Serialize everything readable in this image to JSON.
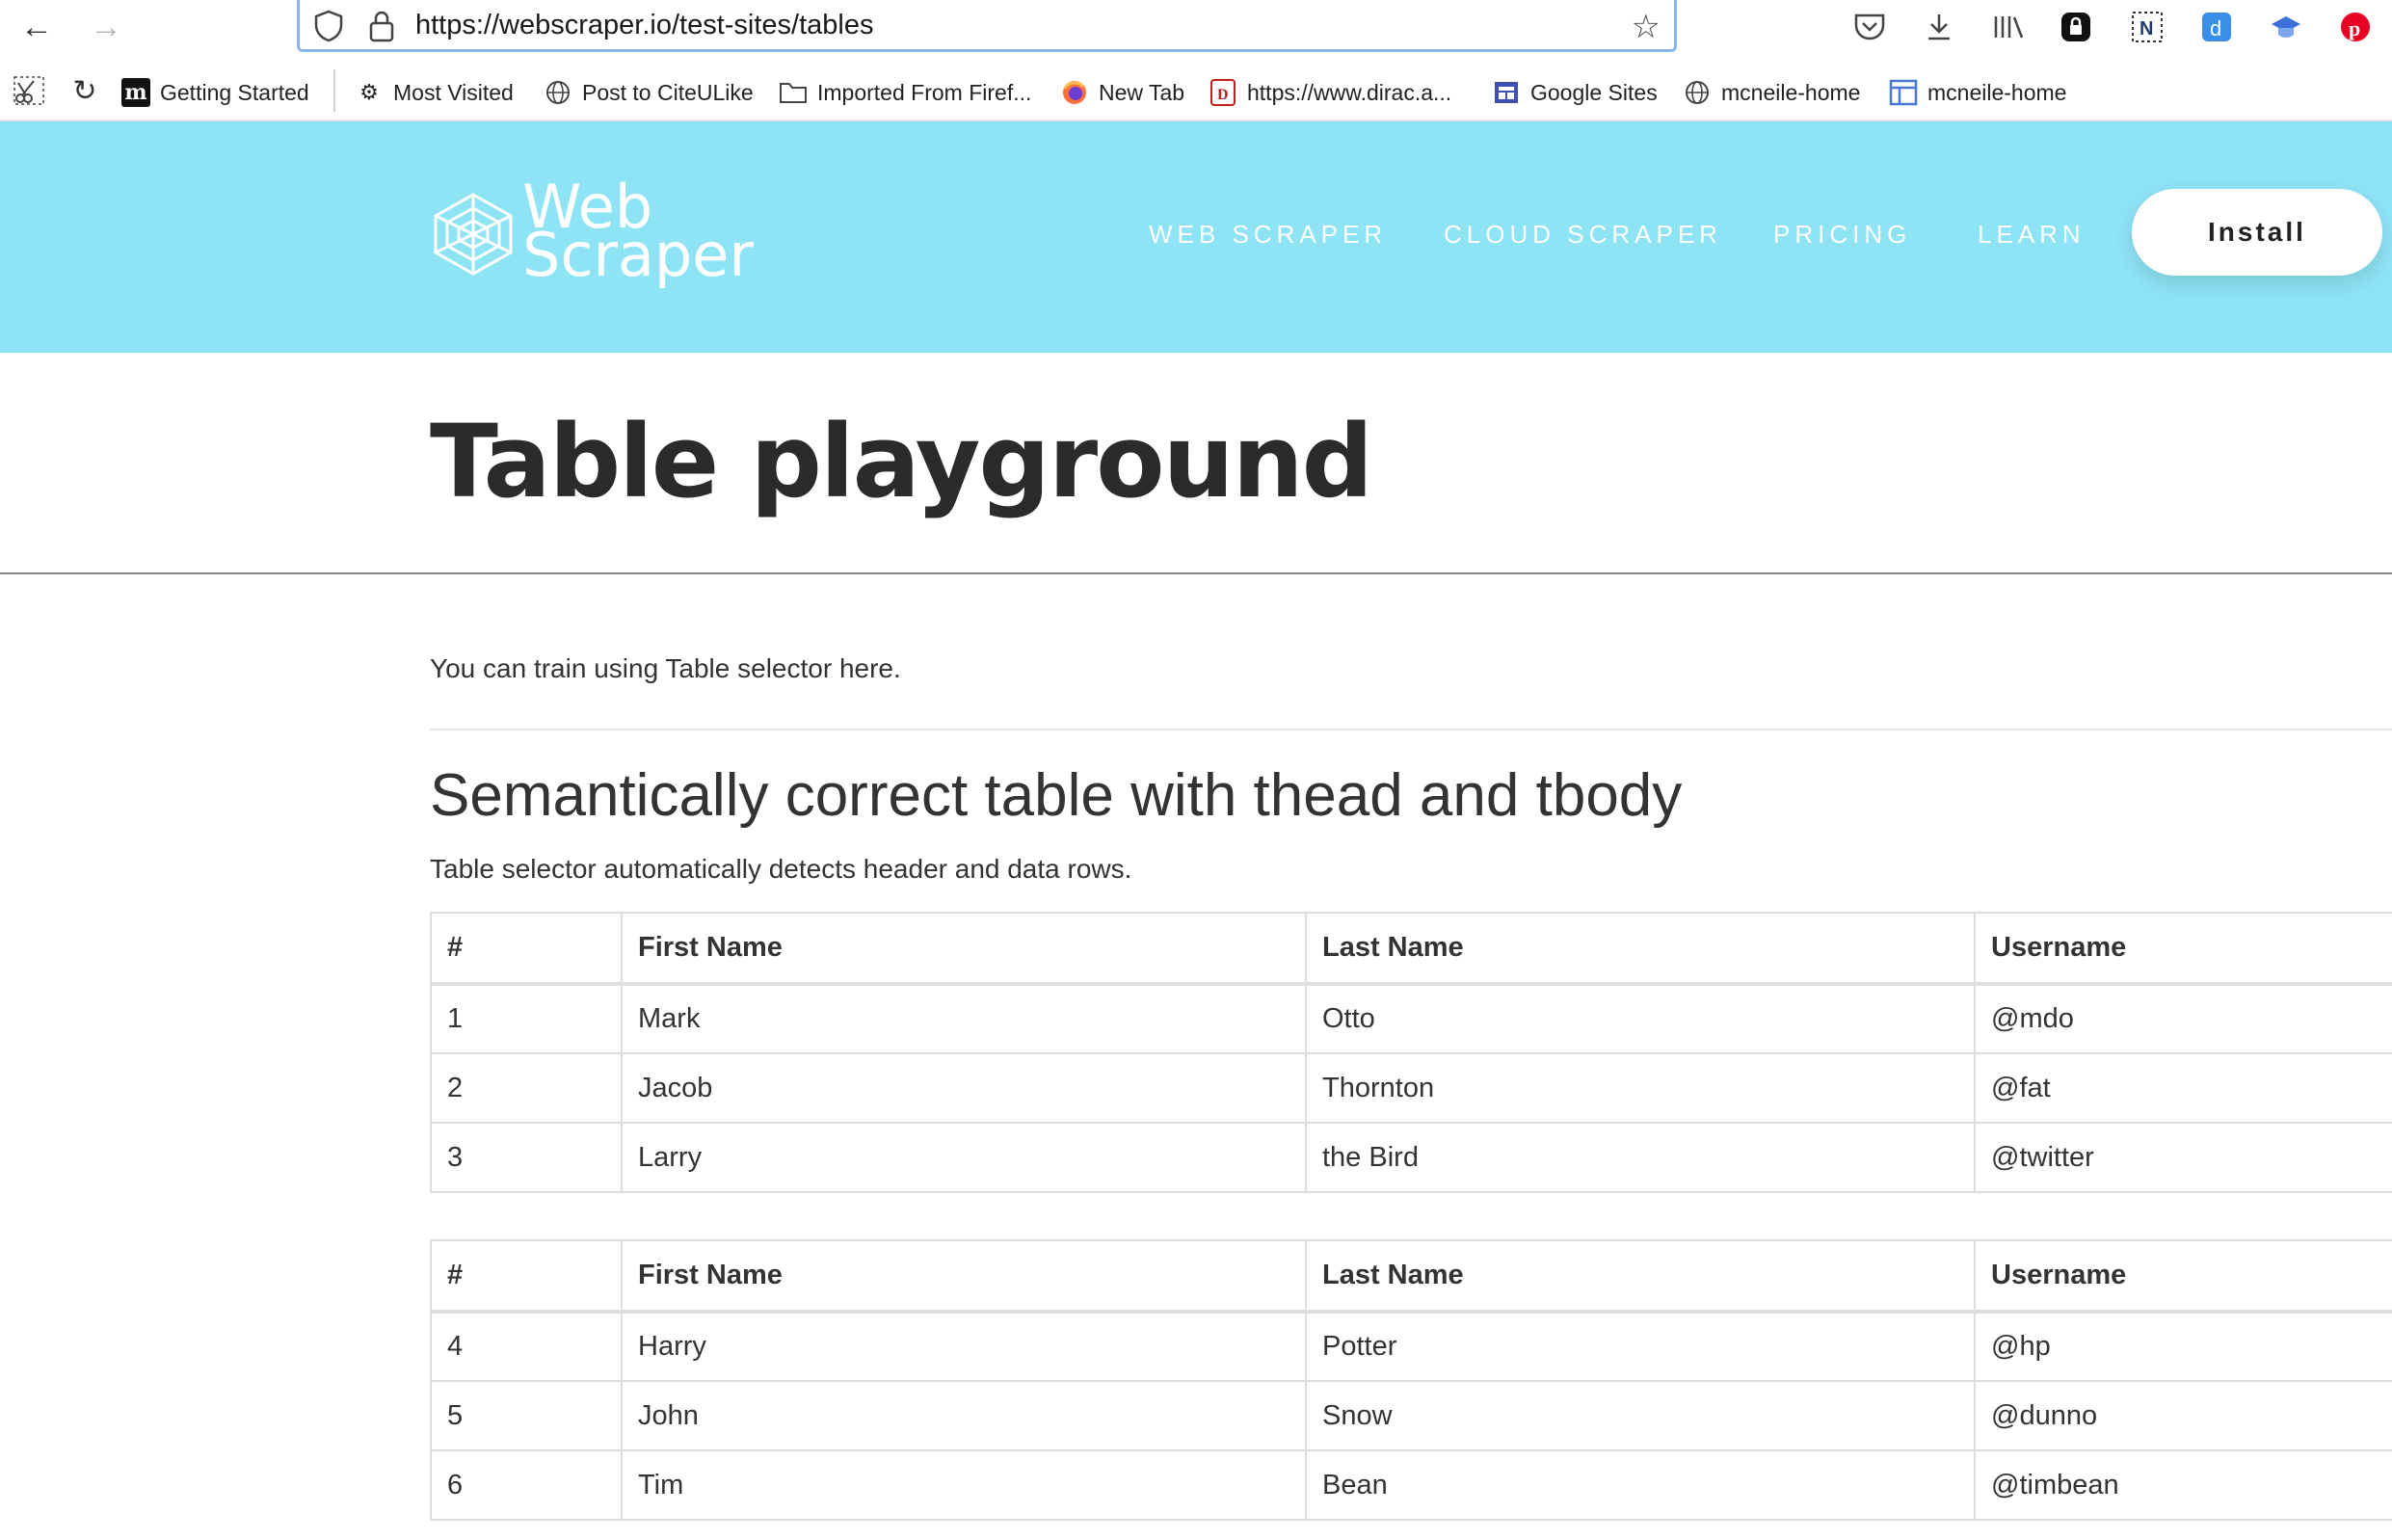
{
  "browser": {
    "url": "https://webscraper.io/test-sites/tables",
    "bookmarks": [
      {
        "label": "Getting Started",
        "icon": "m-logo-icon"
      },
      {
        "label": "Most Visited",
        "icon": "gear-icon"
      },
      {
        "label": "Post to CiteULike",
        "icon": "globe-icon"
      },
      {
        "label": "Imported From Firef...",
        "icon": "folder-icon"
      },
      {
        "label": "New Tab",
        "icon": "firefox-icon"
      },
      {
        "label": "https://www.dirac.a...",
        "icon": "d-logo-icon"
      },
      {
        "label": "Google Sites",
        "icon": "google-sites-icon"
      },
      {
        "label": "mcneile-home",
        "icon": "globe-icon"
      },
      {
        "label": "mcneile-home",
        "icon": "layout-icon"
      }
    ]
  },
  "header": {
    "logo_line1": "Web",
    "logo_line2": "Scraper",
    "menu": [
      "WEB SCRAPER",
      "CLOUD SCRAPER",
      "PRICING",
      "LEARN"
    ],
    "install_label": "Install",
    "colors": {
      "header_bg": "#8ee3f5",
      "text": "#ffffff"
    }
  },
  "page": {
    "title": "Table playground",
    "intro": "You can train using Table selector here.",
    "section_heading": "Semantically correct table with thead and tbody",
    "section_sub": "Table selector automatically detects header and data rows."
  },
  "tables": [
    {
      "headers": [
        "#",
        "First Name",
        "Last Name",
        "Username"
      ],
      "rows": [
        [
          "1",
          "Mark",
          "Otto",
          "@mdo"
        ],
        [
          "2",
          "Jacob",
          "Thornton",
          "@fat"
        ],
        [
          "3",
          "Larry",
          "the Bird",
          "@twitter"
        ]
      ]
    },
    {
      "headers": [
        "#",
        "First Name",
        "Last Name",
        "Username"
      ],
      "rows": [
        [
          "4",
          "Harry",
          "Potter",
          "@hp"
        ],
        [
          "5",
          "John",
          "Snow",
          "@dunno"
        ],
        [
          "6",
          "Tim",
          "Bean",
          "@timbean"
        ]
      ]
    }
  ]
}
